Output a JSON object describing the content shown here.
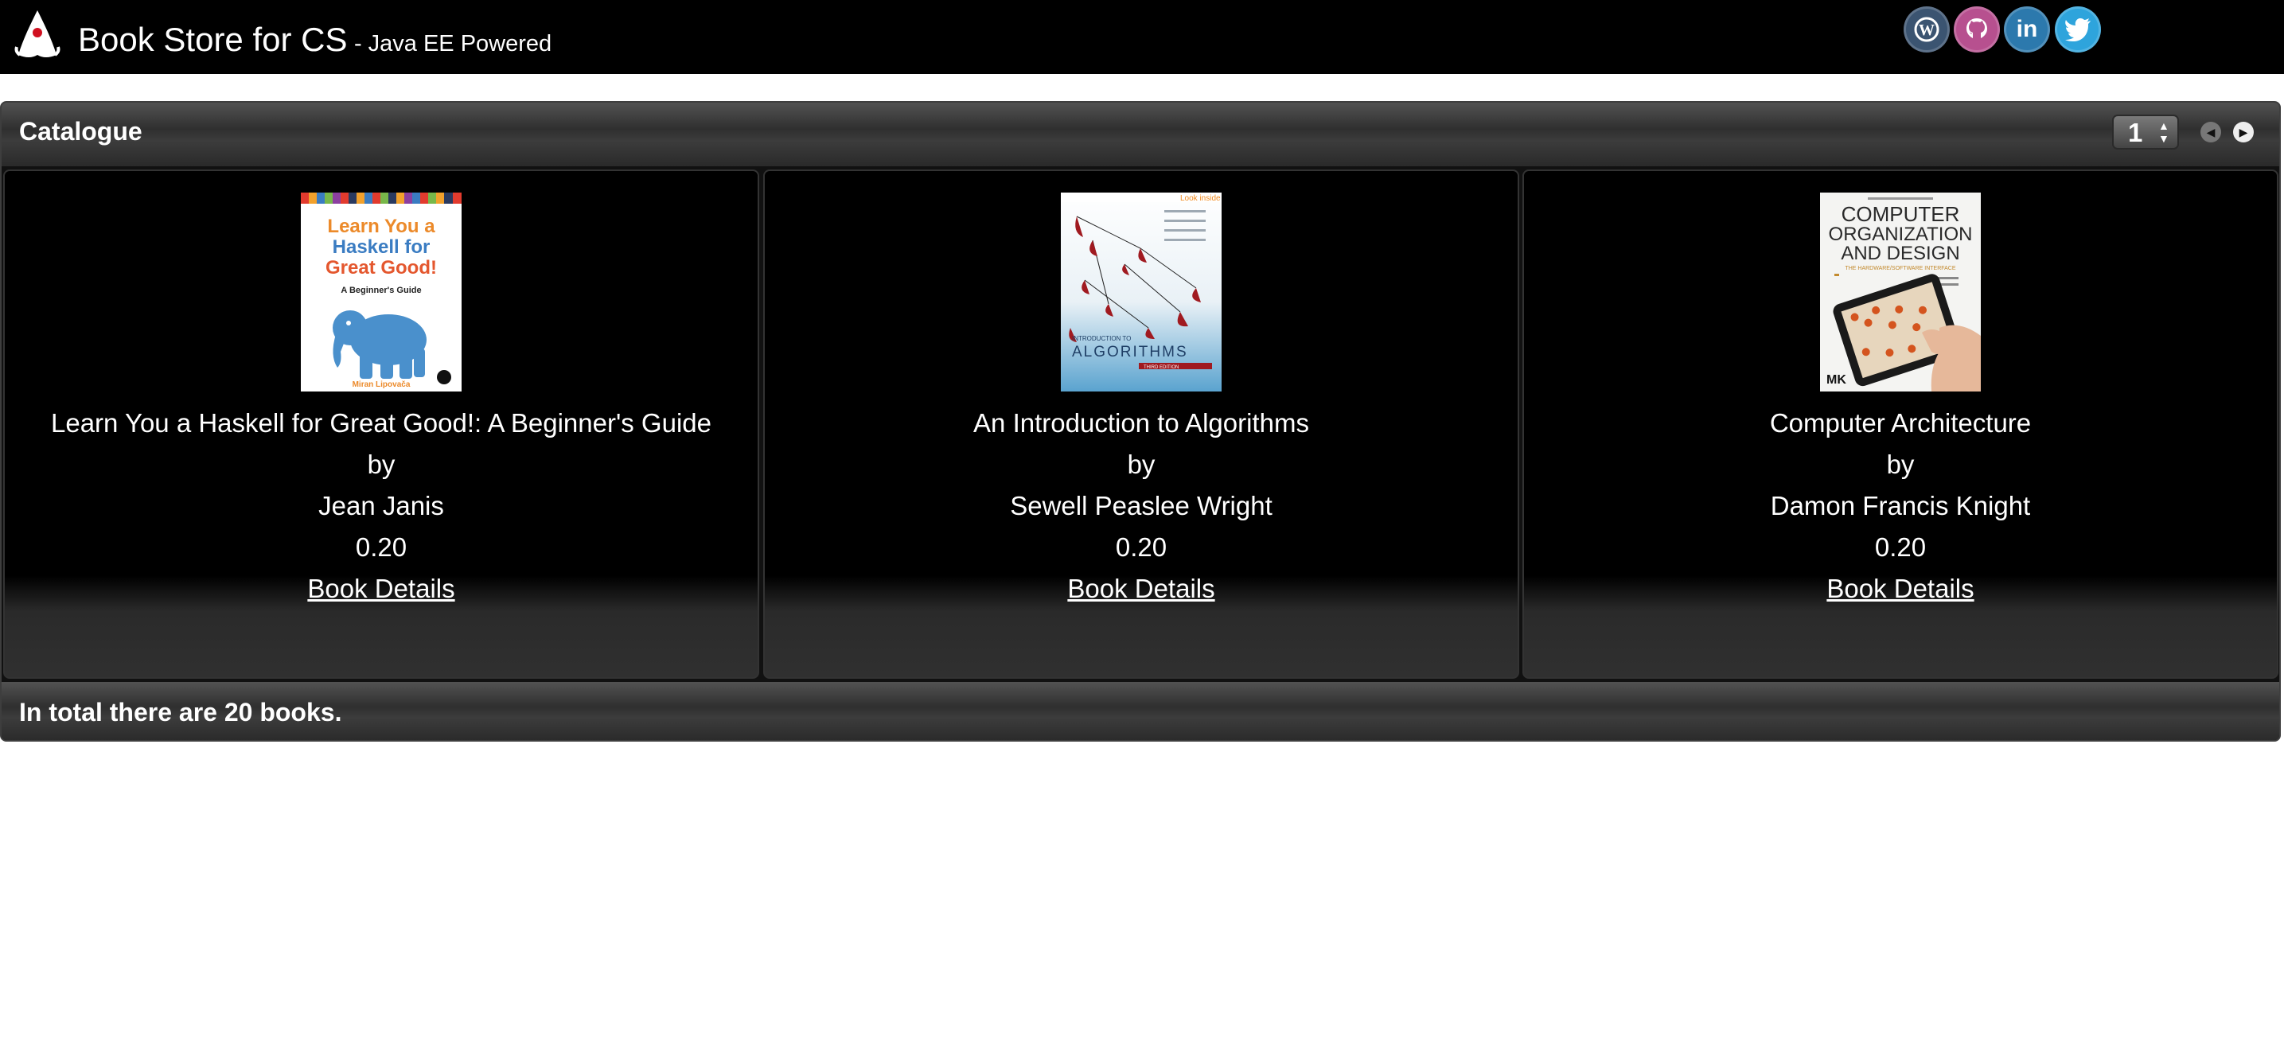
{
  "header": {
    "title": "Book Store for CS",
    "subtitle": "- Java EE Powered",
    "social": [
      {
        "icon": "wordpress-icon",
        "color": "#3b5471"
      },
      {
        "icon": "github-icon",
        "color": "#b7508f"
      },
      {
        "icon": "linkedin-icon",
        "color": "#2c79ad"
      },
      {
        "icon": "twitter-icon",
        "color": "#2ea4dc"
      }
    ]
  },
  "catalogue": {
    "title": "Catalogue",
    "page_value": "1",
    "books": [
      {
        "title": "Learn You a Haskell for Great Good!: A Beginner's Guide",
        "by": "by",
        "author": "Jean Janis",
        "price": "0.20",
        "link": "Book Details",
        "cover": {
          "line1": "Learn You a",
          "line2": "Haskell for",
          "line3": "Great Good!",
          "subtitle": "A Beginner's Guide",
          "author": "Miran Lipovača"
        }
      },
      {
        "title": "An Introduction to Algorithms",
        "by": "by",
        "author": "Sewell Peaslee Wright",
        "price": "0.20",
        "link": "Book Details",
        "cover": {
          "badge": "Look inside",
          "pre": "INTRODUCTION TO",
          "main": "ALGORITHMS",
          "edition": "THIRD EDITION"
        }
      },
      {
        "title": "Computer Architecture",
        "by": "by",
        "author": "Damon Francis Knight",
        "price": "0.20",
        "link": "Book Details",
        "cover": {
          "line1": "COMPUTER",
          "line2": "ORGANIZATION",
          "line3": "AND DESIGN",
          "sub": "THE HARDWARE/SOFTWARE INTERFACE",
          "publisher": "MK"
        }
      }
    ],
    "footer": "In total there are 20 books."
  }
}
